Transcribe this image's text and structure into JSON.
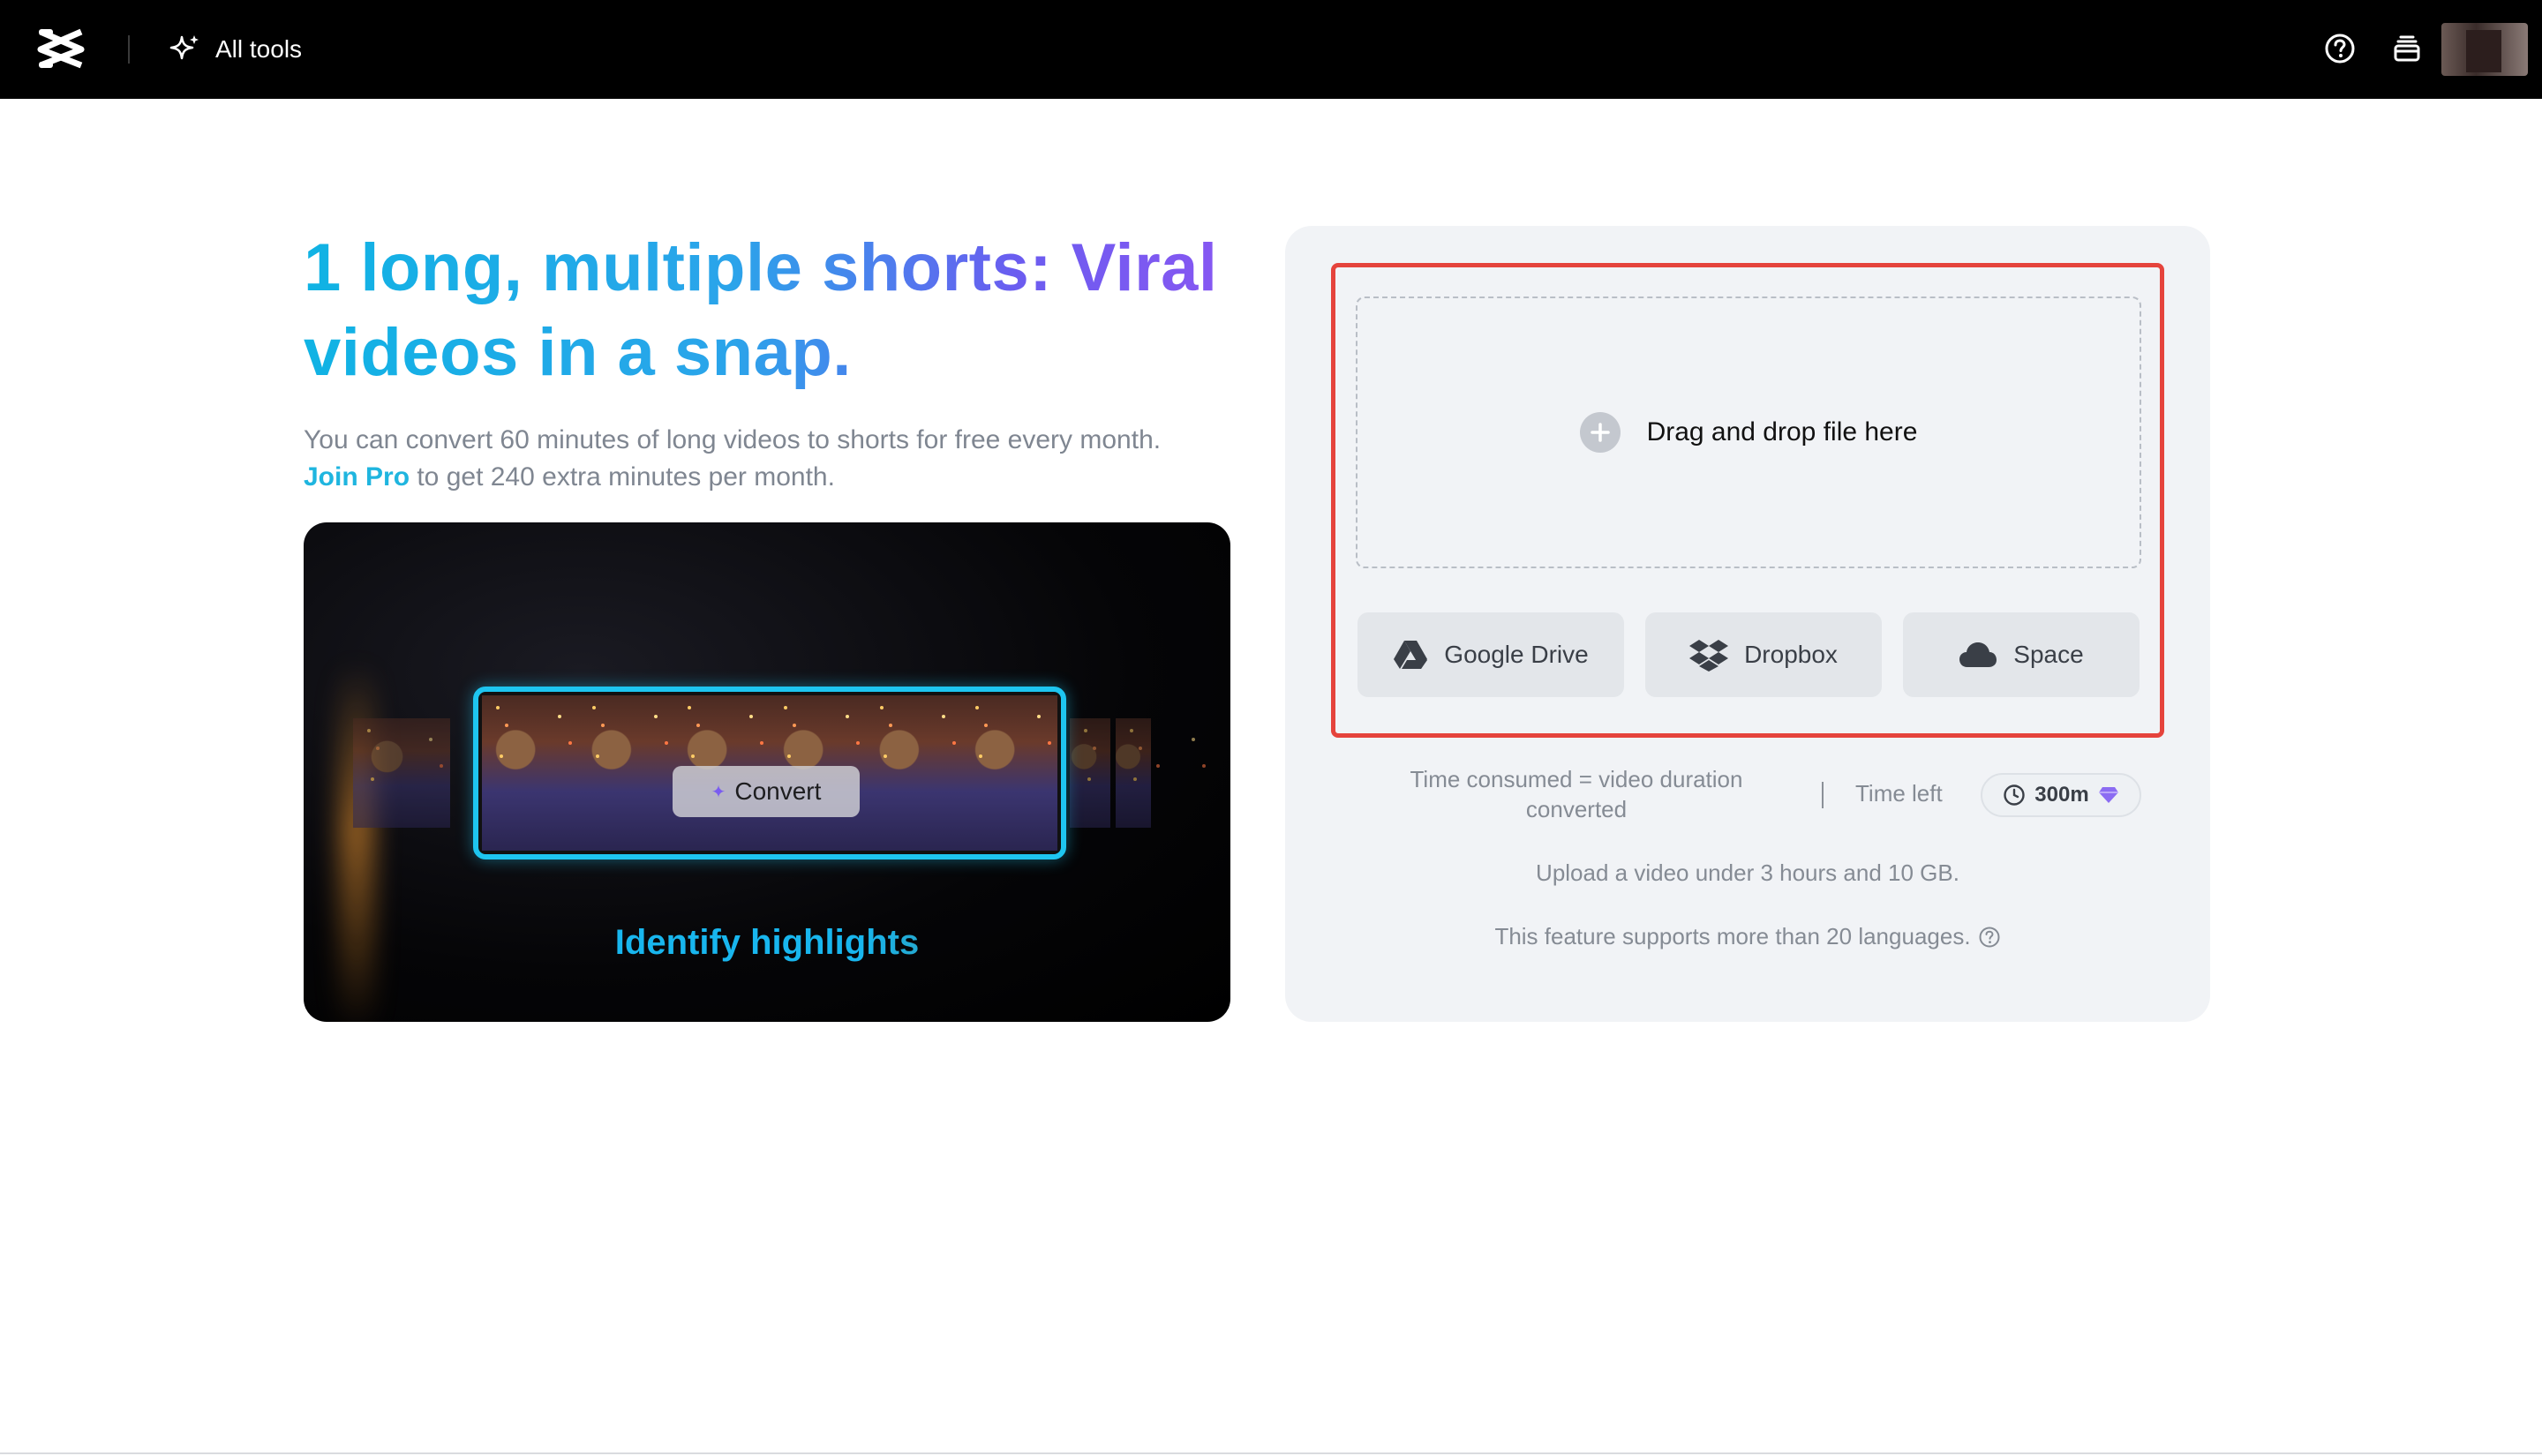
{
  "header": {
    "all_tools_label": "All tools",
    "icons": [
      "capcut-logo-icon",
      "sparkle-icon",
      "help-circle-icon",
      "stack-icon"
    ]
  },
  "hero": {
    "title": "1 long, multiple shorts: Viral videos in a snap.",
    "desc_before": "You can convert 60 minutes of long videos to shorts for free every month. ",
    "desc_link": "Join Pro",
    "desc_after": " to get 240 extra minutes per month."
  },
  "preview": {
    "convert_label": "Convert",
    "caption": "Identify highlights"
  },
  "upload": {
    "drop_label": "Drag and drop file here",
    "sources": [
      {
        "label": "Google Drive",
        "icon": "google-drive-icon"
      },
      {
        "label": "Dropbox",
        "icon": "dropbox-icon"
      },
      {
        "label": "Space",
        "icon": "cloud-icon"
      }
    ],
    "consumed_text": "Time consumed = video duration converted",
    "time_left_label": "Time left",
    "time_left_value": "300m",
    "upload_note": "Upload a video under 3 hours and 10 GB.",
    "lang_note": "This feature supports more than 20 languages."
  },
  "colors": {
    "accent_blue": "#1fb5df",
    "accent_purple": "#8b57f2",
    "highlight_red": "#e5433c",
    "topbar": "#000000"
  }
}
